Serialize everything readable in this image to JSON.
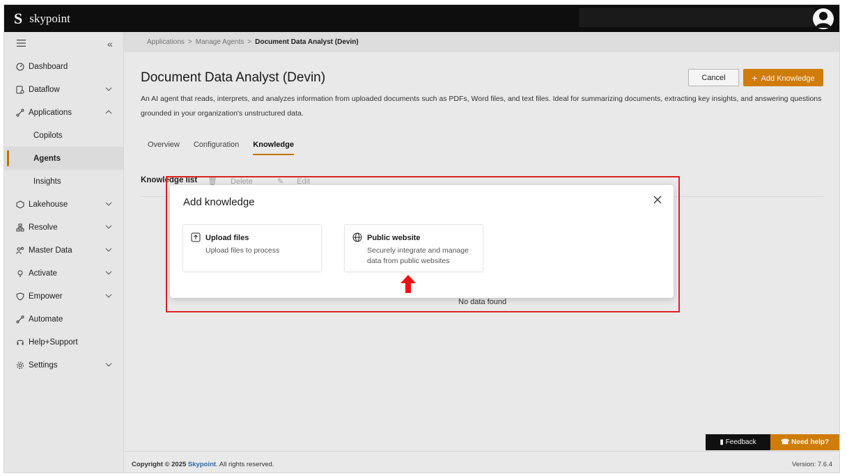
{
  "app": {
    "brand_letter": "S",
    "brand_name": "skypoint"
  },
  "sidebar": {
    "items": [
      {
        "label": "Dashboard"
      },
      {
        "label": "Dataflow"
      },
      {
        "label": "Applications"
      },
      {
        "label": "Copilots"
      },
      {
        "label": "Agents"
      },
      {
        "label": "Insights"
      },
      {
        "label": "Lakehouse"
      },
      {
        "label": "Resolve"
      },
      {
        "label": "Master Data"
      },
      {
        "label": "Activate"
      },
      {
        "label": "Empower"
      },
      {
        "label": "Automate"
      },
      {
        "label": "Help+Support"
      },
      {
        "label": "Settings"
      }
    ],
    "active": "Agents"
  },
  "breadcrumb": {
    "items": [
      "Applications",
      "Manage Agents"
    ],
    "current": "Document Data Analyst (Devin)"
  },
  "page": {
    "title": "Document Data Analyst (Devin)",
    "description": "An AI agent that reads, interprets, and analyzes information from uploaded documents such as PDFs, Word files, and text files. Ideal for summarizing documents, extracting key insights, and answering questions grounded in your organization's unstructured data.",
    "cancel_label": "Cancel",
    "add_label": "Add Knowledge"
  },
  "tabs": [
    {
      "label": "Overview"
    },
    {
      "label": "Configuration"
    },
    {
      "label": "Knowledge",
      "active": true
    }
  ],
  "knowledge": {
    "title": "Knowledge list",
    "delete_label": "Delete",
    "edit_label": "Edit",
    "empty_text": "No data found"
  },
  "modal": {
    "title": "Add knowledge",
    "cards": [
      {
        "title": "Upload files",
        "desc": "Upload files to process",
        "icon": "upload-icon"
      },
      {
        "title": "Public website",
        "desc": "Securely integrate and manage data from public websites",
        "icon": "globe-icon"
      }
    ]
  },
  "footer": {
    "copyright_prefix": "Copyright © 2025",
    "brand": "Skypoint",
    "copyright_suffix": ". All rights reserved.",
    "version": "Version: 7.6.4"
  },
  "support": {
    "feedback_label": "Feedback",
    "help_label": "Need help?"
  },
  "colors": {
    "accent": "#d9820a",
    "highlight": "#e02020",
    "topbar": "#0f0f0f"
  }
}
